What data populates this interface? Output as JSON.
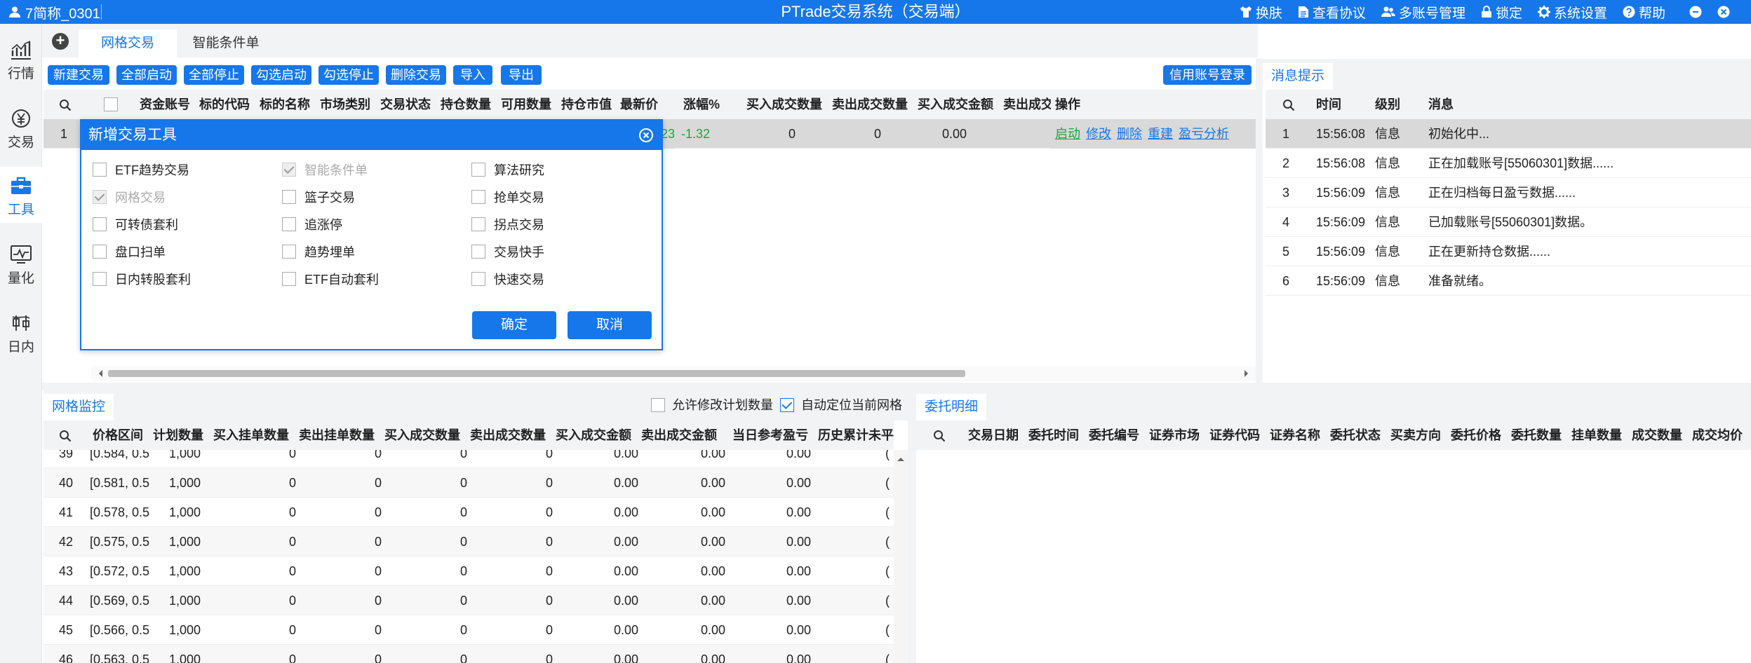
{
  "titlebar": {
    "account": "7简称_0301",
    "title": "PTrade交易系统（交易端）",
    "menu": [
      {
        "icon": "shirt-icon",
        "label": "换肤"
      },
      {
        "icon": "document-icon",
        "label": "查看协议"
      },
      {
        "icon": "users-icon",
        "label": "多账号管理"
      },
      {
        "icon": "lock-icon",
        "label": "锁定"
      },
      {
        "icon": "gear-icon",
        "label": "系统设置"
      },
      {
        "icon": "help-icon",
        "label": "帮助"
      }
    ]
  },
  "sidebar": {
    "items": [
      {
        "label": "行情",
        "icon": "chart-icon"
      },
      {
        "label": "交易",
        "icon": "yen-icon"
      },
      {
        "label": "工具",
        "icon": "toolbox-icon"
      },
      {
        "label": "量化",
        "icon": "monitor-icon"
      },
      {
        "label": "日内",
        "icon": "intraday-icon"
      }
    ]
  },
  "top_tabs": [
    "网格交易",
    "智能条件单"
  ],
  "toolbar": {
    "buttons": [
      "新建交易",
      "全部启动",
      "全部停止",
      "勾选启动",
      "勾选停止",
      "删除交易",
      "导入",
      "导出"
    ],
    "credit_login": "信用账号登录"
  },
  "grid_table": {
    "headers": [
      "资金账号",
      "标的代码",
      "标的名称",
      "市场类别",
      "交易状态",
      "持仓数量",
      "可用数量",
      "持仓市值",
      "最新价",
      "涨幅%",
      "买入成交数量",
      "卖出成交数量",
      "买入成交金额",
      "卖出成交",
      "操作"
    ],
    "row": {
      "index": "1",
      "price_tail": "23",
      "change": "-1.32",
      "buy_qty": "0",
      "sell_qty": "0",
      "buy_amount": "0.00",
      "actions": [
        "启动",
        "修改",
        "删除",
        "重建",
        "盈亏分析"
      ]
    }
  },
  "dialog": {
    "title": "新增交易工具",
    "options": [
      {
        "label": "ETF趋势交易",
        "state": "unchecked"
      },
      {
        "label": "智能条件单",
        "state": "disabled-checked"
      },
      {
        "label": "算法研究",
        "state": "unchecked"
      },
      {
        "label": "网格交易",
        "state": "disabled-checked"
      },
      {
        "label": "篮子交易",
        "state": "unchecked"
      },
      {
        "label": "抢单交易",
        "state": "unchecked"
      },
      {
        "label": "可转债套利",
        "state": "unchecked"
      },
      {
        "label": "追涨停",
        "state": "unchecked"
      },
      {
        "label": "拐点交易",
        "state": "unchecked"
      },
      {
        "label": "盘口扫单",
        "state": "unchecked"
      },
      {
        "label": "趋势埋单",
        "state": "unchecked"
      },
      {
        "label": "交易快手",
        "state": "unchecked"
      },
      {
        "label": "日内转股套利",
        "state": "unchecked"
      },
      {
        "label": "ETF自动套利",
        "state": "unchecked"
      },
      {
        "label": "快速交易",
        "state": "unchecked"
      }
    ],
    "confirm": "确定",
    "cancel": "取消"
  },
  "messages": {
    "tab": "消息提示",
    "headers": [
      "时间",
      "级别",
      "消息"
    ],
    "rows": [
      {
        "index": "1",
        "time": "15:56:08",
        "level": "信息",
        "text": "初始化中..."
      },
      {
        "index": "2",
        "time": "15:56:08",
        "level": "信息",
        "text": "正在加载账号[55060301]数据......"
      },
      {
        "index": "3",
        "time": "15:56:09",
        "level": "信息",
        "text": "正在归档每日盈亏数据......"
      },
      {
        "index": "4",
        "time": "15:56:09",
        "level": "信息",
        "text": "已加载账号[55060301]数据。"
      },
      {
        "index": "5",
        "time": "15:56:09",
        "level": "信息",
        "text": "正在更新持仓数据......"
      },
      {
        "index": "6",
        "time": "15:56:09",
        "level": "信息",
        "text": "准备就绪。"
      }
    ]
  },
  "grid_monitor": {
    "tab": "网格监控",
    "allow_modify": "允许修改计划数量",
    "auto_locate": "自动定位当前网格",
    "headers": [
      "价格区间",
      "计划数量",
      "买入挂单数量",
      "卖出挂单数量",
      "买入成交数量",
      "卖出成交数量",
      "买入成交金额",
      "卖出成交金额",
      "当日参考盈亏",
      "历史累计未平"
    ],
    "rows": [
      {
        "index": "39",
        "range": "[0.584, 0.5",
        "plan": "1,000",
        "bpo": "0",
        "spo": "0",
        "bq": "0",
        "sq": "0",
        "ba": "0.00",
        "sa": "0.00",
        "pnl": "0.00",
        "hist": "("
      },
      {
        "index": "40",
        "range": "[0.581, 0.5",
        "plan": "1,000",
        "bpo": "0",
        "spo": "0",
        "bq": "0",
        "sq": "0",
        "ba": "0.00",
        "sa": "0.00",
        "pnl": "0.00",
        "hist": "("
      },
      {
        "index": "41",
        "range": "[0.578, 0.5",
        "plan": "1,000",
        "bpo": "0",
        "spo": "0",
        "bq": "0",
        "sq": "0",
        "ba": "0.00",
        "sa": "0.00",
        "pnl": "0.00",
        "hist": "("
      },
      {
        "index": "42",
        "range": "[0.575, 0.5",
        "plan": "1,000",
        "bpo": "0",
        "spo": "0",
        "bq": "0",
        "sq": "0",
        "ba": "0.00",
        "sa": "0.00",
        "pnl": "0.00",
        "hist": "("
      },
      {
        "index": "43",
        "range": "[0.572, 0.5",
        "plan": "1,000",
        "bpo": "0",
        "spo": "0",
        "bq": "0",
        "sq": "0",
        "ba": "0.00",
        "sa": "0.00",
        "pnl": "0.00",
        "hist": "("
      },
      {
        "index": "44",
        "range": "[0.569, 0.5",
        "plan": "1,000",
        "bpo": "0",
        "spo": "0",
        "bq": "0",
        "sq": "0",
        "ba": "0.00",
        "sa": "0.00",
        "pnl": "0.00",
        "hist": "("
      },
      {
        "index": "45",
        "range": "[0.566, 0.5",
        "plan": "1,000",
        "bpo": "0",
        "spo": "0",
        "bq": "0",
        "sq": "0",
        "ba": "0.00",
        "sa": "0.00",
        "pnl": "0.00",
        "hist": "("
      },
      {
        "index": "46",
        "range": "[0.563, 0.5",
        "plan": "1,000",
        "bpo": "0",
        "spo": "0",
        "bq": "0",
        "sq": "0",
        "ba": "0.00",
        "sa": "0.00",
        "pnl": "0.00",
        "hist": "("
      }
    ]
  },
  "orders": {
    "tab": "委托明细",
    "headers": [
      "交易日期",
      "委托时间",
      "委托编号",
      "证券市场",
      "证券代码",
      "证券名称",
      "委托状态",
      "买卖方向",
      "委托价格",
      "委托数量",
      "挂单数量",
      "成交数量",
      "成交均价"
    ]
  },
  "colors": {
    "accent": "#1677ea",
    "negative": "#1aa53b",
    "header_bg": "#f2f3f5"
  }
}
